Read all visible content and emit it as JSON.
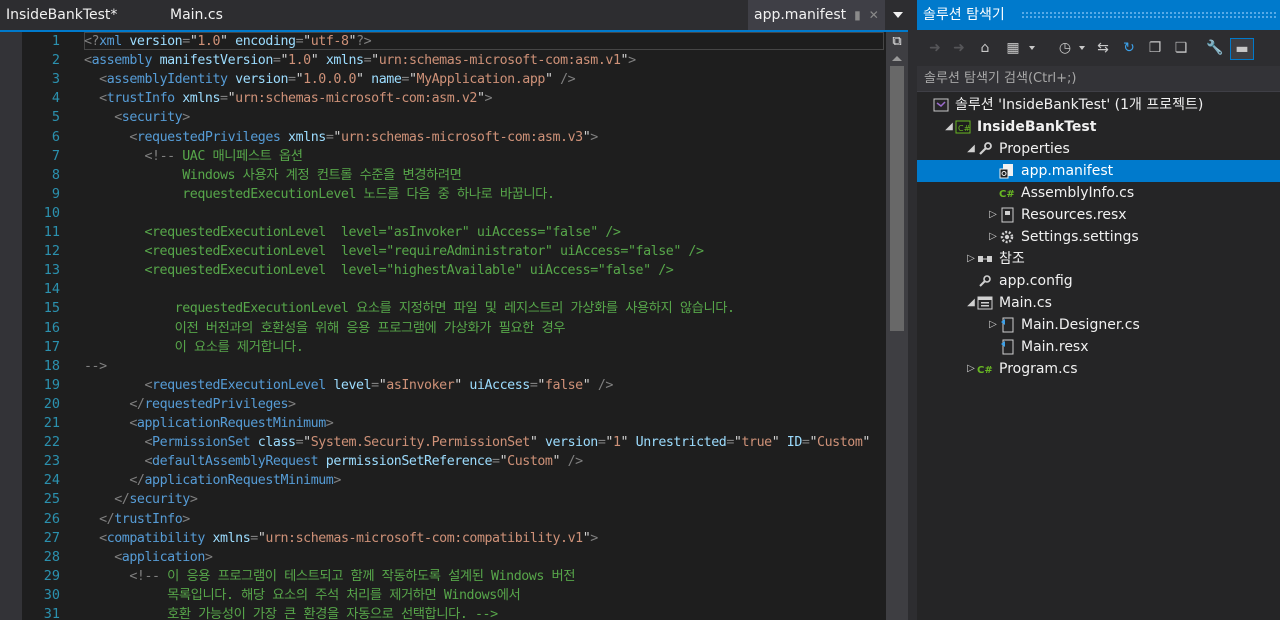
{
  "tabs": [
    {
      "label": "InsideBankTest*"
    },
    {
      "label": "Main.cs"
    },
    {
      "label": "app.manifest",
      "active": true
    }
  ],
  "editor": {
    "line_numbers": [
      "1",
      "2",
      "3",
      "4",
      "5",
      "6",
      "7",
      "8",
      "9",
      "10",
      "11",
      "12",
      "13",
      "14",
      "15",
      "16",
      "17",
      "18",
      "19",
      "20",
      "21",
      "22",
      "23",
      "24",
      "25",
      "26",
      "27",
      "28",
      "29",
      "30",
      "31"
    ],
    "code_lines": [
      [
        [
          "b",
          "<?"
        ],
        [
          "e",
          "xml"
        ],
        [
          "a",
          " version"
        ],
        [
          "b",
          "="
        ],
        [
          "d",
          "\""
        ],
        [
          "v",
          "1.0"
        ],
        [
          "d",
          "\""
        ],
        [
          "a",
          " encoding"
        ],
        [
          "b",
          "="
        ],
        [
          "d",
          "\""
        ],
        [
          "v",
          "utf-8"
        ],
        [
          "d",
          "\""
        ],
        [
          "b",
          "?>"
        ]
      ],
      [
        [
          "b",
          "<"
        ],
        [
          "e",
          "assembly"
        ],
        [
          "a",
          " manifestVersion"
        ],
        [
          "b",
          "="
        ],
        [
          "d",
          "\""
        ],
        [
          "v",
          "1.0"
        ],
        [
          "d",
          "\""
        ],
        [
          "a",
          " xmlns"
        ],
        [
          "b",
          "="
        ],
        [
          "d",
          "\""
        ],
        [
          "v",
          "urn:schemas-microsoft-com:asm.v1"
        ],
        [
          "d",
          "\""
        ],
        [
          "b",
          ">"
        ]
      ],
      [
        [
          "d",
          "  "
        ],
        [
          "b",
          "<"
        ],
        [
          "e",
          "assemblyIdentity"
        ],
        [
          "a",
          " version"
        ],
        [
          "b",
          "="
        ],
        [
          "d",
          "\""
        ],
        [
          "v",
          "1.0.0.0"
        ],
        [
          "d",
          "\""
        ],
        [
          "a",
          " name"
        ],
        [
          "b",
          "="
        ],
        [
          "d",
          "\""
        ],
        [
          "v",
          "MyApplication.app"
        ],
        [
          "d",
          "\""
        ],
        [
          "b",
          " />"
        ]
      ],
      [
        [
          "d",
          "  "
        ],
        [
          "b",
          "<"
        ],
        [
          "e",
          "trustInfo"
        ],
        [
          "a",
          " xmlns"
        ],
        [
          "b",
          "="
        ],
        [
          "d",
          "\""
        ],
        [
          "v",
          "urn:schemas-microsoft-com:asm.v2"
        ],
        [
          "d",
          "\""
        ],
        [
          "b",
          ">"
        ]
      ],
      [
        [
          "d",
          "    "
        ],
        [
          "b",
          "<"
        ],
        [
          "e",
          "security"
        ],
        [
          "b",
          ">"
        ]
      ],
      [
        [
          "d",
          "      "
        ],
        [
          "b",
          "<"
        ],
        [
          "e",
          "requestedPrivileges"
        ],
        [
          "a",
          " xmlns"
        ],
        [
          "b",
          "="
        ],
        [
          "d",
          "\""
        ],
        [
          "v",
          "urn:schemas-microsoft-com:asm.v3"
        ],
        [
          "d",
          "\""
        ],
        [
          "b",
          ">"
        ]
      ],
      [
        [
          "d",
          "        "
        ],
        [
          "b",
          "<!--"
        ],
        [
          "c",
          " UAC 매니페스트 옵션"
        ]
      ],
      [
        [
          "c",
          "             Windows 사용자 계정 컨트롤 수준을 변경하려면"
        ]
      ],
      [
        [
          "c",
          "             requestedExecutionLevel 노드를 다음 중 하나로 바꿉니다."
        ]
      ],
      [
        [
          "c",
          ""
        ]
      ],
      [
        [
          "c",
          "        <requestedExecutionLevel  level=\"asInvoker\" uiAccess=\"false\" />"
        ]
      ],
      [
        [
          "c",
          "        <requestedExecutionLevel  level=\"requireAdministrator\" uiAccess=\"false\" />"
        ]
      ],
      [
        [
          "c",
          "        <requestedExecutionLevel  level=\"highestAvailable\" uiAccess=\"false\" />"
        ]
      ],
      [
        [
          "c",
          ""
        ]
      ],
      [
        [
          "c",
          "            requestedExecutionLevel 요소를 지정하면 파일 및 레지스트리 가상화를 사용하지 않습니다."
        ]
      ],
      [
        [
          "c",
          "            이전 버전과의 호환성을 위해 응용 프로그램에 가상화가 필요한 경우"
        ]
      ],
      [
        [
          "c",
          "            이 요소를 제거합니다."
        ]
      ],
      [
        [
          "b",
          "-->"
        ]
      ],
      [
        [
          "d",
          "        "
        ],
        [
          "b",
          "<"
        ],
        [
          "e",
          "requestedExecutionLevel"
        ],
        [
          "a",
          " level"
        ],
        [
          "b",
          "="
        ],
        [
          "d",
          "\""
        ],
        [
          "v",
          "asInvoker"
        ],
        [
          "d",
          "\""
        ],
        [
          "a",
          " uiAccess"
        ],
        [
          "b",
          "="
        ],
        [
          "d",
          "\""
        ],
        [
          "v",
          "false"
        ],
        [
          "d",
          "\""
        ],
        [
          "b",
          " />"
        ]
      ],
      [
        [
          "d",
          "      "
        ],
        [
          "b",
          "</"
        ],
        [
          "e",
          "requestedPrivileges"
        ],
        [
          "b",
          ">"
        ]
      ],
      [
        [
          "d",
          "      "
        ],
        [
          "b",
          "<"
        ],
        [
          "e",
          "applicationRequestMinimum"
        ],
        [
          "b",
          ">"
        ]
      ],
      [
        [
          "d",
          "        "
        ],
        [
          "b",
          "<"
        ],
        [
          "e",
          "PermissionSet"
        ],
        [
          "a",
          " class"
        ],
        [
          "b",
          "="
        ],
        [
          "d",
          "\""
        ],
        [
          "v",
          "System.Security.PermissionSet"
        ],
        [
          "d",
          "\""
        ],
        [
          "a",
          " version"
        ],
        [
          "b",
          "="
        ],
        [
          "d",
          "\""
        ],
        [
          "v",
          "1"
        ],
        [
          "d",
          "\""
        ],
        [
          "a",
          " Unrestricted"
        ],
        [
          "b",
          "="
        ],
        [
          "d",
          "\""
        ],
        [
          "v",
          "true"
        ],
        [
          "d",
          "\""
        ],
        [
          "a",
          " ID"
        ],
        [
          "b",
          "="
        ],
        [
          "d",
          "\""
        ],
        [
          "v",
          "Custom"
        ],
        [
          "d",
          "\""
        ]
      ],
      [
        [
          "d",
          "        "
        ],
        [
          "b",
          "<"
        ],
        [
          "e",
          "defaultAssemblyRequest"
        ],
        [
          "a",
          " permissionSetReference"
        ],
        [
          "b",
          "="
        ],
        [
          "d",
          "\""
        ],
        [
          "v",
          "Custom"
        ],
        [
          "d",
          "\""
        ],
        [
          "b",
          " />"
        ]
      ],
      [
        [
          "d",
          "      "
        ],
        [
          "b",
          "</"
        ],
        [
          "e",
          "applicationRequestMinimum"
        ],
        [
          "b",
          ">"
        ]
      ],
      [
        [
          "d",
          "    "
        ],
        [
          "b",
          "</"
        ],
        [
          "e",
          "security"
        ],
        [
          "b",
          ">"
        ]
      ],
      [
        [
          "d",
          "  "
        ],
        [
          "b",
          "</"
        ],
        [
          "e",
          "trustInfo"
        ],
        [
          "b",
          ">"
        ]
      ],
      [
        [
          "d",
          "  "
        ],
        [
          "b",
          "<"
        ],
        [
          "e",
          "compatibility"
        ],
        [
          "a",
          " xmlns"
        ],
        [
          "b",
          "="
        ],
        [
          "d",
          "\""
        ],
        [
          "v",
          "urn:schemas-microsoft-com:compatibility.v1"
        ],
        [
          "d",
          "\""
        ],
        [
          "b",
          ">"
        ]
      ],
      [
        [
          "d",
          "    "
        ],
        [
          "b",
          "<"
        ],
        [
          "e",
          "application"
        ],
        [
          "b",
          ">"
        ]
      ],
      [
        [
          "d",
          "      "
        ],
        [
          "b",
          "<!--"
        ],
        [
          "c",
          " 이 응용 프로그램이 테스트되고 함께 작동하도록 설계된 Windows 버전"
        ]
      ],
      [
        [
          "c",
          "           목록입니다. 해당 요소의 주석 처리를 제거하면 Windows에서"
        ]
      ],
      [
        [
          "c",
          "           호환 가능성이 가장 큰 환경을 자동으로 선택합니다. -->"
        ]
      ]
    ]
  },
  "solution_explorer": {
    "title": "솔루션 탐색기",
    "search_placeholder": "솔루션 탐색기 검색(Ctrl+;)",
    "toolbar_icons": [
      "back-icon",
      "forward-icon",
      "home-icon",
      "switch-views-icon",
      "pending-changes-filter-icon",
      "sync-icon",
      "refresh-icon",
      "collapse-all-icon",
      "show-all-files-icon",
      "properties-icon",
      "preview-icon"
    ],
    "tree": [
      {
        "label": "솔루션 'InsideBankTest' (1개 프로젝트)",
        "icon": "solution-icon",
        "expander": "",
        "depth": 0,
        "bold": false
      },
      {
        "label": "InsideBankTest",
        "icon": "csharp-project-icon",
        "expander": "open",
        "depth": 1,
        "bold": true
      },
      {
        "label": "Properties",
        "icon": "wrench-icon",
        "expander": "open",
        "depth": 2,
        "bold": false
      },
      {
        "label": "app.manifest",
        "icon": "manifest-icon",
        "expander": "",
        "depth": 3,
        "bold": false,
        "selected": true
      },
      {
        "label": "AssemblyInfo.cs",
        "icon": "csharp-file-icon",
        "expander": "",
        "depth": 3,
        "bold": false
      },
      {
        "label": "Resources.resx",
        "icon": "resx-icon",
        "expander": "closed",
        "depth": 3,
        "bold": false
      },
      {
        "label": "Settings.settings",
        "icon": "settings-gear-icon",
        "expander": "closed",
        "depth": 3,
        "bold": false
      },
      {
        "label": "참조",
        "icon": "references-icon",
        "expander": "closed",
        "depth": 2,
        "bold": false
      },
      {
        "label": "app.config",
        "icon": "config-icon",
        "expander": "",
        "depth": 2,
        "bold": false
      },
      {
        "label": "Main.cs",
        "icon": "form-icon",
        "expander": "open",
        "depth": 2,
        "bold": false
      },
      {
        "label": "Main.Designer.cs",
        "icon": "designer-file-icon",
        "expander": "closed",
        "depth": 3,
        "bold": false
      },
      {
        "label": "Main.resx",
        "icon": "resx-file-icon",
        "expander": "",
        "depth": 3,
        "bold": false
      },
      {
        "label": "Program.cs",
        "icon": "csharp-file-icon",
        "expander": "closed",
        "depth": 2,
        "bold": false
      }
    ]
  },
  "colors": {
    "accent": "#007acc",
    "editor_bg": "#1e1e1e",
    "line_number": "#2b91af",
    "xml_element": "#569cd6",
    "xml_attribute": "#9cdcfe",
    "xml_value": "#ce9178",
    "comment": "#57a64a"
  }
}
